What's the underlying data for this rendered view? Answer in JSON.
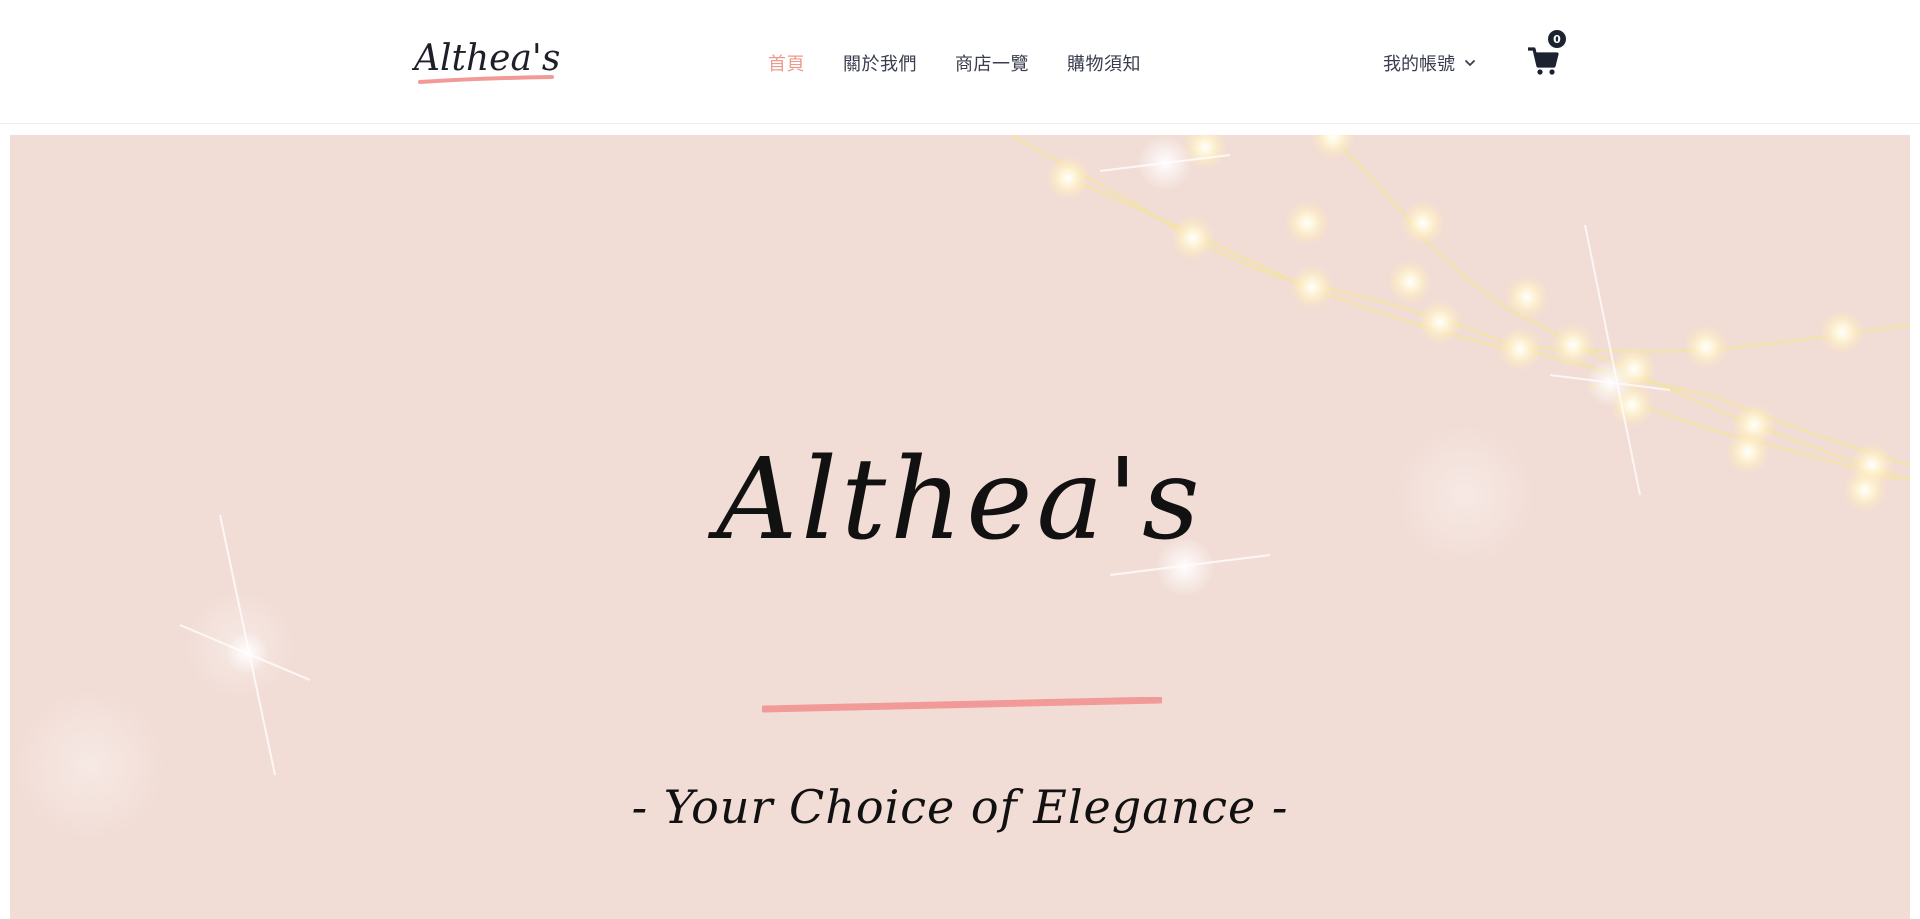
{
  "header": {
    "logo_text": "Althea's",
    "nav": [
      {
        "label": "首頁",
        "active": true
      },
      {
        "label": "關於我們",
        "active": false
      },
      {
        "label": "商店一覽",
        "active": false
      },
      {
        "label": "購物須知",
        "active": false
      }
    ],
    "account_label": "我的帳號",
    "account_icon": "chevron-down-icon",
    "cart_icon": "shopping-cart-icon",
    "cart_count": "0"
  },
  "hero": {
    "title": "Althea's",
    "tagline": "- Your Choice of Elegance -",
    "background_color": "#f2ddd6",
    "underline_color": "#f29a98",
    "decoration": "string-lights-and-sparkles"
  },
  "colors": {
    "accent": "#ef9a8f",
    "nav_text": "#3a3d4f",
    "badge": "#1c2230"
  }
}
